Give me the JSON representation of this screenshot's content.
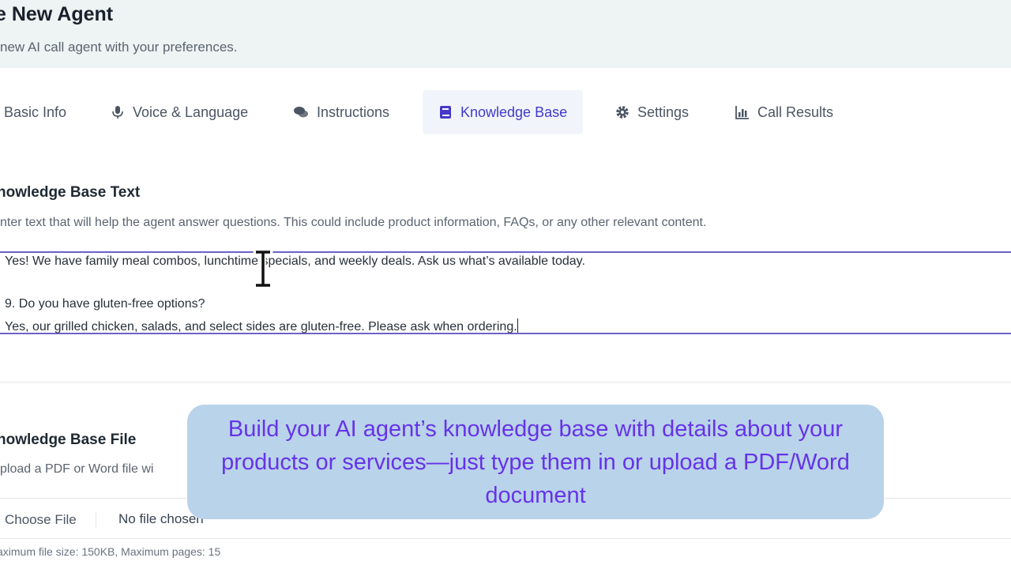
{
  "header": {
    "title": "e New Agent",
    "subtitle": "new AI call agent with your preferences."
  },
  "tabs": [
    {
      "label": "Basic Info",
      "icon": "info-icon"
    },
    {
      "label": "Voice & Language",
      "icon": "microphone-icon"
    },
    {
      "label": "Instructions",
      "icon": "chat-bubbles-icon"
    },
    {
      "label": "Knowledge Base",
      "icon": "book-icon",
      "active": true
    },
    {
      "label": "Settings",
      "icon": "gear-icon"
    },
    {
      "label": "Call Results",
      "icon": "bar-chart-icon"
    }
  ],
  "kb_text": {
    "title": "nowledge Base Text",
    "description": "nter text that will help the agent answer questions. This could include product information, FAQs, or any other relevant content.",
    "lines": [
      "Yes! We have family meal combos, lunchtime specials, and weekly deals. Ask us what’s available today.",
      "",
      "9. Do you have gluten-free options?",
      "Yes, our grilled chicken, salads, and select sides are gluten-free. Please ask when ordering."
    ]
  },
  "kb_file": {
    "title": "nowledge Base File",
    "description": "pload a PDF or Word file wi",
    "choose_label": "Choose File",
    "status": "No file chosen",
    "hint": "aximum file size: 150KB, Maximum pages: 15"
  },
  "callout": {
    "text": "Build your AI agent’s knowledge base with details about your products or services—just type them in or upload a PDF/Word document"
  },
  "colors": {
    "accent": "#4338ca",
    "callout_bg": "#b9d3ea",
    "callout_text": "#6633e8",
    "focus_border": "#6b63c7"
  }
}
